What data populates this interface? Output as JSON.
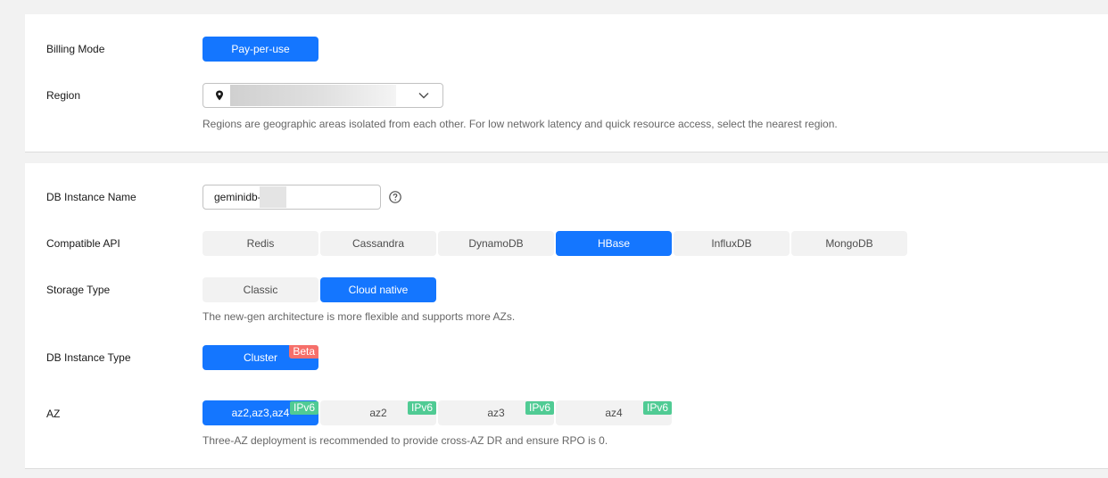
{
  "billing": {
    "label": "Billing Mode",
    "option": "Pay-per-use"
  },
  "region": {
    "label": "Region",
    "hint": "Regions are geographic areas isolated from each other. For low network latency and quick resource access, select the nearest region.",
    "icons": {
      "location": "location-pin-icon",
      "dropdown": "chevron-down-icon"
    }
  },
  "instance_name": {
    "label": "DB Instance Name",
    "value": "geminidb-",
    "help_icon": "question-circle-icon"
  },
  "compatible_api": {
    "label": "Compatible API",
    "options": [
      "Redis",
      "Cassandra",
      "DynamoDB",
      "HBase",
      "InfluxDB",
      "MongoDB"
    ],
    "selected": "HBase"
  },
  "storage_type": {
    "label": "Storage Type",
    "options": [
      "Classic",
      "Cloud native"
    ],
    "selected": "Cloud native",
    "hint": "The new-gen architecture is more flexible and supports more AZs."
  },
  "instance_type": {
    "label": "DB Instance Type",
    "option": "Cluster",
    "badge": "Beta"
  },
  "az": {
    "label": "AZ",
    "options": [
      "az2,az3,az4",
      "az2",
      "az3",
      "az4"
    ],
    "badge": "IPv6",
    "selected": "az2,az3,az4",
    "hint": "Three-AZ deployment is recommended to provide cross-AZ DR and ensure RPO is 0."
  },
  "colors": {
    "accent": "#1476ff",
    "beta_badge": "#f66f6a",
    "ipv6_badge": "#50cb94"
  }
}
